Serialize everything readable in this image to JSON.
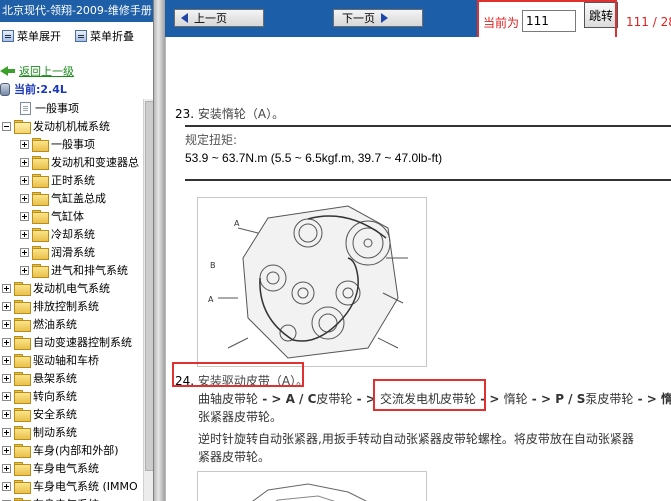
{
  "left_panel": {
    "title": "北京现代-领翔-2009-维修手册",
    "expand_label": "菜单展开",
    "collapse_label": "菜单折叠",
    "back_label": "返回上一级",
    "current_label": "当前:2.4L",
    "tree": [
      {
        "label": "一般事项",
        "level": 0,
        "type": "doc"
      },
      {
        "label": "发动机机械系统",
        "level": 0,
        "type": "folder-open"
      },
      {
        "label": "一般事项",
        "level": 1,
        "type": "folder"
      },
      {
        "label": "发动机和变速器总",
        "level": 1,
        "type": "folder"
      },
      {
        "label": "正时系统",
        "level": 1,
        "type": "folder"
      },
      {
        "label": "气缸盖总成",
        "level": 1,
        "type": "folder"
      },
      {
        "label": "气缸体",
        "level": 1,
        "type": "folder"
      },
      {
        "label": "冷却系统",
        "level": 1,
        "type": "folder"
      },
      {
        "label": "润滑系统",
        "level": 1,
        "type": "folder"
      },
      {
        "label": "进气和排气系统",
        "level": 1,
        "type": "folder"
      },
      {
        "label": "发动机电气系统",
        "level": 0,
        "type": "folder"
      },
      {
        "label": "排放控制系统",
        "level": 0,
        "type": "folder"
      },
      {
        "label": "燃油系统",
        "level": 0,
        "type": "folder"
      },
      {
        "label": "自动变速器控制系统",
        "level": 0,
        "type": "folder"
      },
      {
        "label": "驱动轴和车桥",
        "level": 0,
        "type": "folder"
      },
      {
        "label": "悬架系统",
        "level": 0,
        "type": "folder"
      },
      {
        "label": "转向系统",
        "level": 0,
        "type": "folder"
      },
      {
        "label": "安全系统",
        "level": 0,
        "type": "folder"
      },
      {
        "label": "制动系统",
        "level": 0,
        "type": "folder"
      },
      {
        "label": "车身(内部和外部)",
        "level": 0,
        "type": "folder"
      },
      {
        "label": "车身电气系统",
        "level": 0,
        "type": "folder"
      },
      {
        "label": "车身电气系统 (IMMO",
        "level": 0,
        "type": "folder"
      },
      {
        "label": "车身电气系统",
        "level": 0,
        "type": "folder"
      }
    ]
  },
  "toolbar": {
    "prev_label": "上一页",
    "next_label": "下一页",
    "current_page_label": "当前为",
    "page_value": "111",
    "jump_label": "跳转",
    "page_count": "111 / 28"
  },
  "content": {
    "step23_num": "23.",
    "step23_text": "安装惰轮（A）。",
    "torque_label": "规定扭矩:",
    "torque_value": "53.9 ~ 63.7N.m (5.5 ~ 6.5kgf.m, 39.7 ~ 47.0lb-ft)",
    "step24_num": "24.",
    "step24_text": "安装驱动皮带（A）。",
    "p1_a": "曲轴皮带轮",
    "p1_b": " - > A / C",
    "p1_c": "皮带轮",
    "p1_d": " - > ",
    "p1_e": "交流发电机皮带轮",
    "p1_f": " - > ",
    "p1_g": "惰轮",
    "p1_h": " - > P / S",
    "p1_i": "泵皮带轮",
    "p1_j": " - > 惰",
    "p2": "张紧器皮带轮。",
    "p3": "逆时针旋转自动张紧器,用扳手转动自动张紧器皮带轮螺栓。将皮带放在自动张紧器",
    "p4": "紧器皮带轮。",
    "figure_labels": [
      "A",
      "B",
      "A"
    ]
  },
  "colors": {
    "nav_blue": "#1c5ea8",
    "highlight_red": "#e03030",
    "back_green": "#1a8a1a",
    "current_blue": "#1a38b8"
  }
}
